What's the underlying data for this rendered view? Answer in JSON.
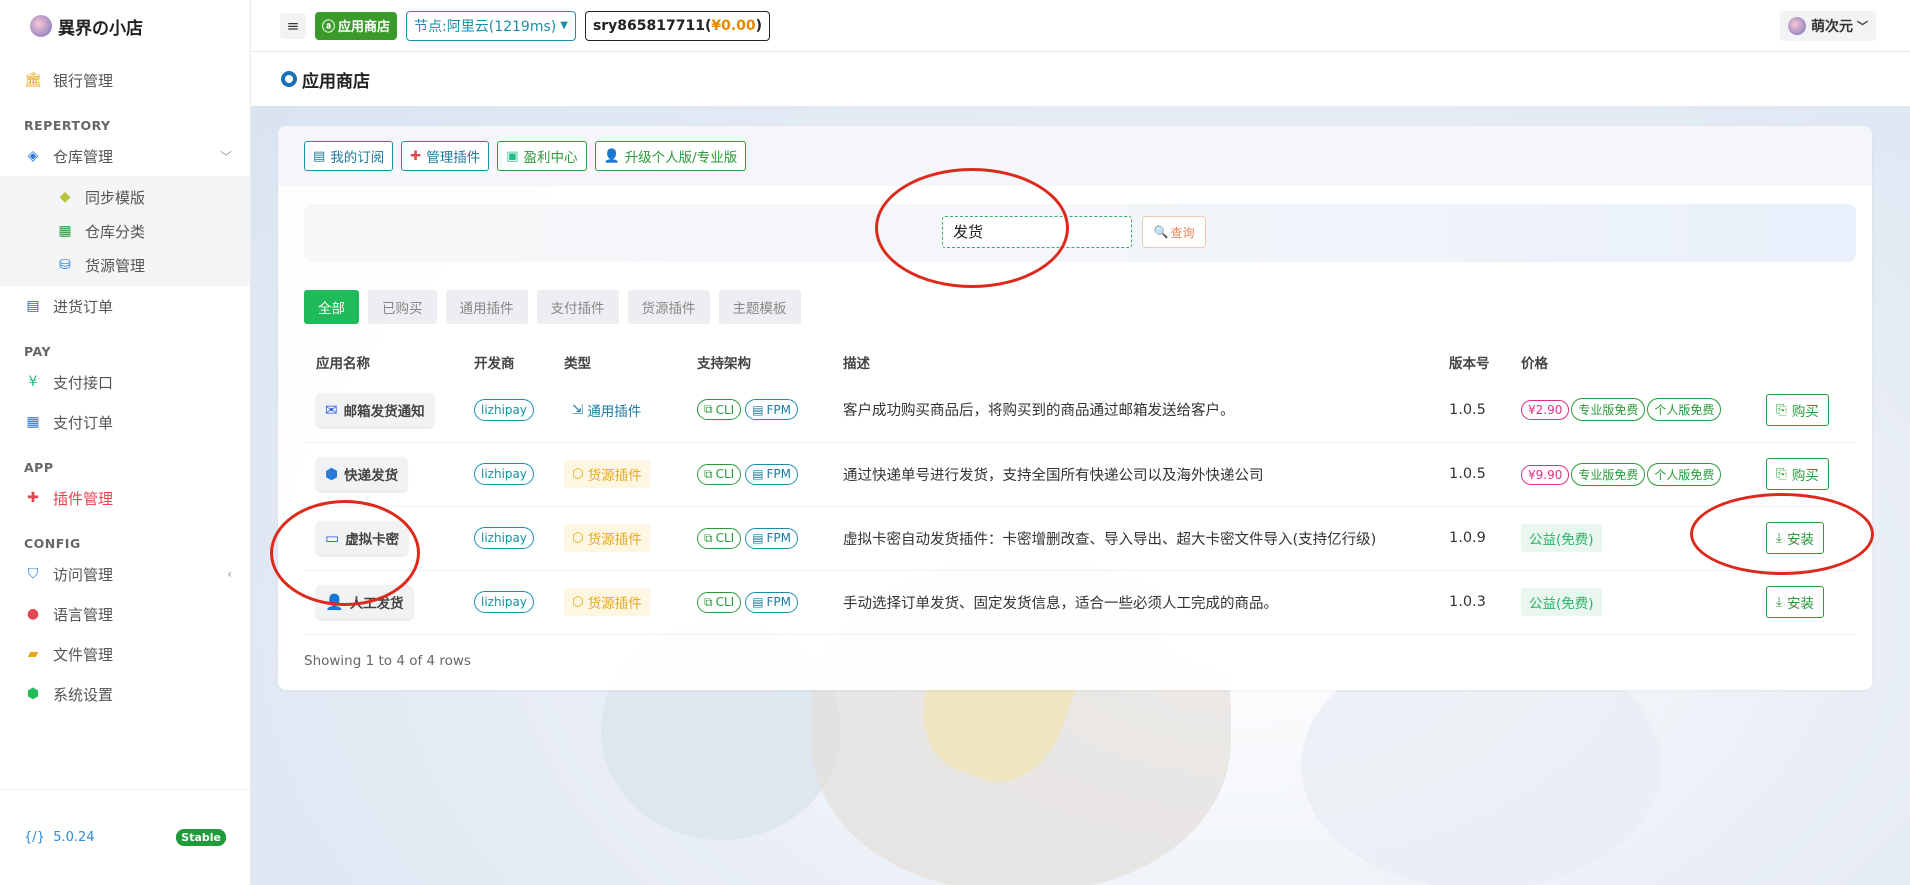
{
  "brand": "異界の小店",
  "sidebar": {
    "items": [
      {
        "label": "银行管理",
        "icon": "bank-icon"
      },
      {
        "section": "REPERTORY"
      },
      {
        "label": "仓库管理",
        "icon": "warehouse-icon"
      },
      {
        "label": "同步模版",
        "icon": "tag-icon",
        "sub": true
      },
      {
        "label": "仓库分类",
        "icon": "grid-icon",
        "sub": true
      },
      {
        "label": "货源管理",
        "icon": "source-icon",
        "sub": true
      },
      {
        "label": "进货订单",
        "icon": "clipboard-icon"
      },
      {
        "section": "PAY"
      },
      {
        "label": "支付接口",
        "icon": "yen-icon"
      },
      {
        "label": "支付订单",
        "icon": "calendar-icon"
      },
      {
        "section": "APP"
      },
      {
        "label": "插件管理",
        "icon": "puzzle-icon",
        "active": true
      },
      {
        "section": "CONFIG"
      },
      {
        "label": "访问管理",
        "icon": "shield-icon"
      },
      {
        "label": "语言管理",
        "icon": "globe-icon"
      },
      {
        "label": "文件管理",
        "icon": "folder-icon"
      },
      {
        "label": "系统设置",
        "icon": "hexagon-icon"
      }
    ],
    "version": "5.0.24",
    "stable": "Stable"
  },
  "topbar": {
    "menu": "≡",
    "store": "应用商店",
    "node": "节点:阿里云(1219ms)",
    "account_prefix": "sry865817711(",
    "balance": "¥0.00",
    "account_suffix": ")",
    "user": "萌次元"
  },
  "page": {
    "title": "应用商店",
    "head_buttons": {
      "subscribe": "我的订阅",
      "manage": "管理插件",
      "profit": "盈利中心",
      "upgrade": "升级个人版/专业版"
    },
    "search": {
      "value": "发货",
      "button": "查询"
    },
    "filters": [
      "全部",
      "已购买",
      "通用插件",
      "支付插件",
      "货源插件",
      "主题模板"
    ],
    "columns": [
      "应用名称",
      "开发商",
      "类型",
      "支持架构",
      "描述",
      "版本号",
      "价格"
    ],
    "rows": [
      {
        "name": "邮箱发货通知",
        "icon": "mail-icon",
        "dev": "lizhipay",
        "type": "通用插件",
        "cli": "CLI",
        "fpm": "FPM",
        "desc": "客户成功购买商品后，将购买到的商品通过邮箱发送给客户。",
        "version": "1.0.5",
        "price": "¥2.90",
        "pro": "专业版免费",
        "personal": "个人版免费",
        "action": "购买"
      },
      {
        "name": "快递发货",
        "icon": "box-icon",
        "dev": "lizhipay",
        "type": "货源插件",
        "cli": "CLI",
        "fpm": "FPM",
        "desc": "通过快递单号进行发货，支持全国所有快递公司以及海外快递公司",
        "version": "1.0.5",
        "price": "¥9.90",
        "pro": "专业版免费",
        "personal": "个人版免费",
        "action": "购买"
      },
      {
        "name": "虚拟卡密",
        "icon": "card-icon",
        "dev": "lizhipay",
        "type": "货源插件",
        "cli": "CLI",
        "fpm": "FPM",
        "desc": "虚拟卡密自动发货插件：卡密增删改查、导入导出、超大卡密文件导入(支持亿行级)",
        "version": "1.0.9",
        "free": "公益(免费)",
        "action": "安装"
      },
      {
        "name": "人工发货",
        "icon": "person-icon",
        "dev": "lizhipay",
        "type": "货源插件",
        "cli": "CLI",
        "fpm": "FPM",
        "desc": "手动选择订单发货、固定发货信息，适合一些必须人工完成的商品。",
        "version": "1.0.3",
        "free": "公益(免费)",
        "action": "安装"
      }
    ],
    "footer": "Showing 1 to 4 of 4 rows"
  },
  "colors": {
    "accent_green": "#1fbb5a",
    "annotation_red": "#dd2a1d",
    "teal": "#1d8fa8"
  }
}
